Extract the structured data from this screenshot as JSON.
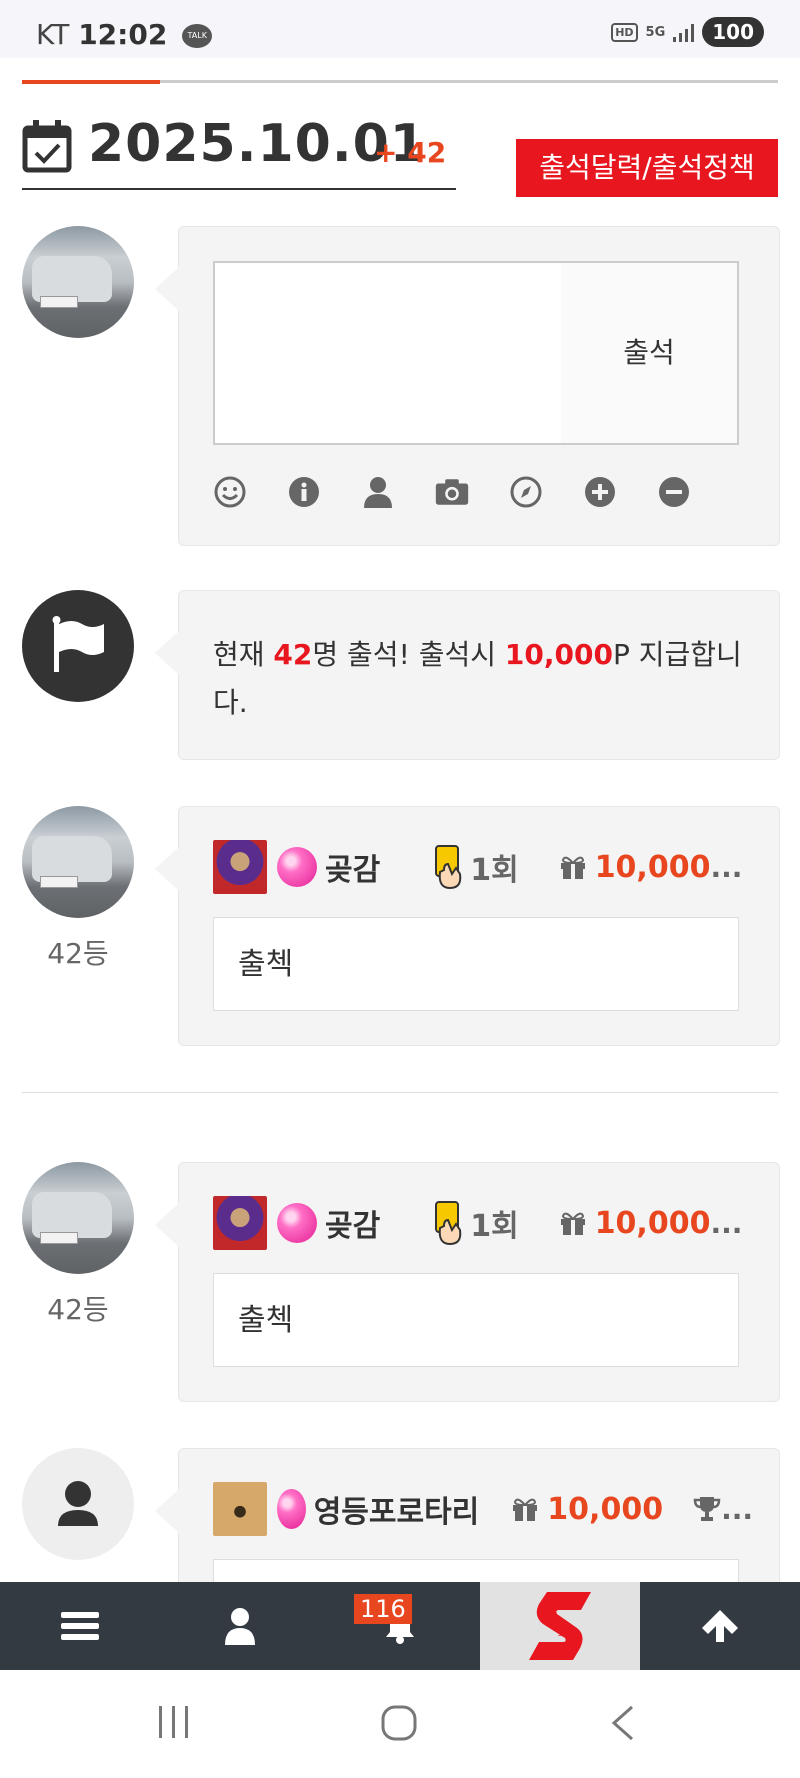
{
  "status_bar": {
    "carrier": "KT",
    "time": "12:02",
    "talk_badge": "TALK",
    "hd": "HD",
    "network": "5G",
    "battery": "100"
  },
  "header": {
    "date": "2025.10.01",
    "count_delta": "+ 42",
    "policy_button": "출석달력/출석정책"
  },
  "checkin_form": {
    "textarea_value": "",
    "submit_label": "출석",
    "tools": [
      "smile-icon",
      "info-icon",
      "user-icon",
      "camera-icon",
      "compass-icon",
      "plus-circle-icon",
      "minus-circle-icon"
    ]
  },
  "notice": {
    "t1": "현재 ",
    "count": "42",
    "t2": "명 출석! 출석시 ",
    "points": "10,000",
    "t3": "P 지급합니다."
  },
  "entries": [
    {
      "rank": "42등",
      "nickname": "곶감",
      "card_count": "1회",
      "points": "10,000",
      "ellipsis": "...",
      "comment": "출첵"
    },
    {
      "rank": "42등",
      "nickname": "곶감",
      "card_count": "1회",
      "points": "10,000",
      "ellipsis": "...",
      "comment": "출첵"
    },
    {
      "nickname": "영등포로타리",
      "points": "10,000",
      "ellipsis": "..."
    }
  ],
  "bottom_nav": {
    "notification_count": "116",
    "logo": "S"
  },
  "colors": {
    "accent": "#e8461e",
    "red": "#e8161e",
    "nav_bg": "#333a41"
  }
}
